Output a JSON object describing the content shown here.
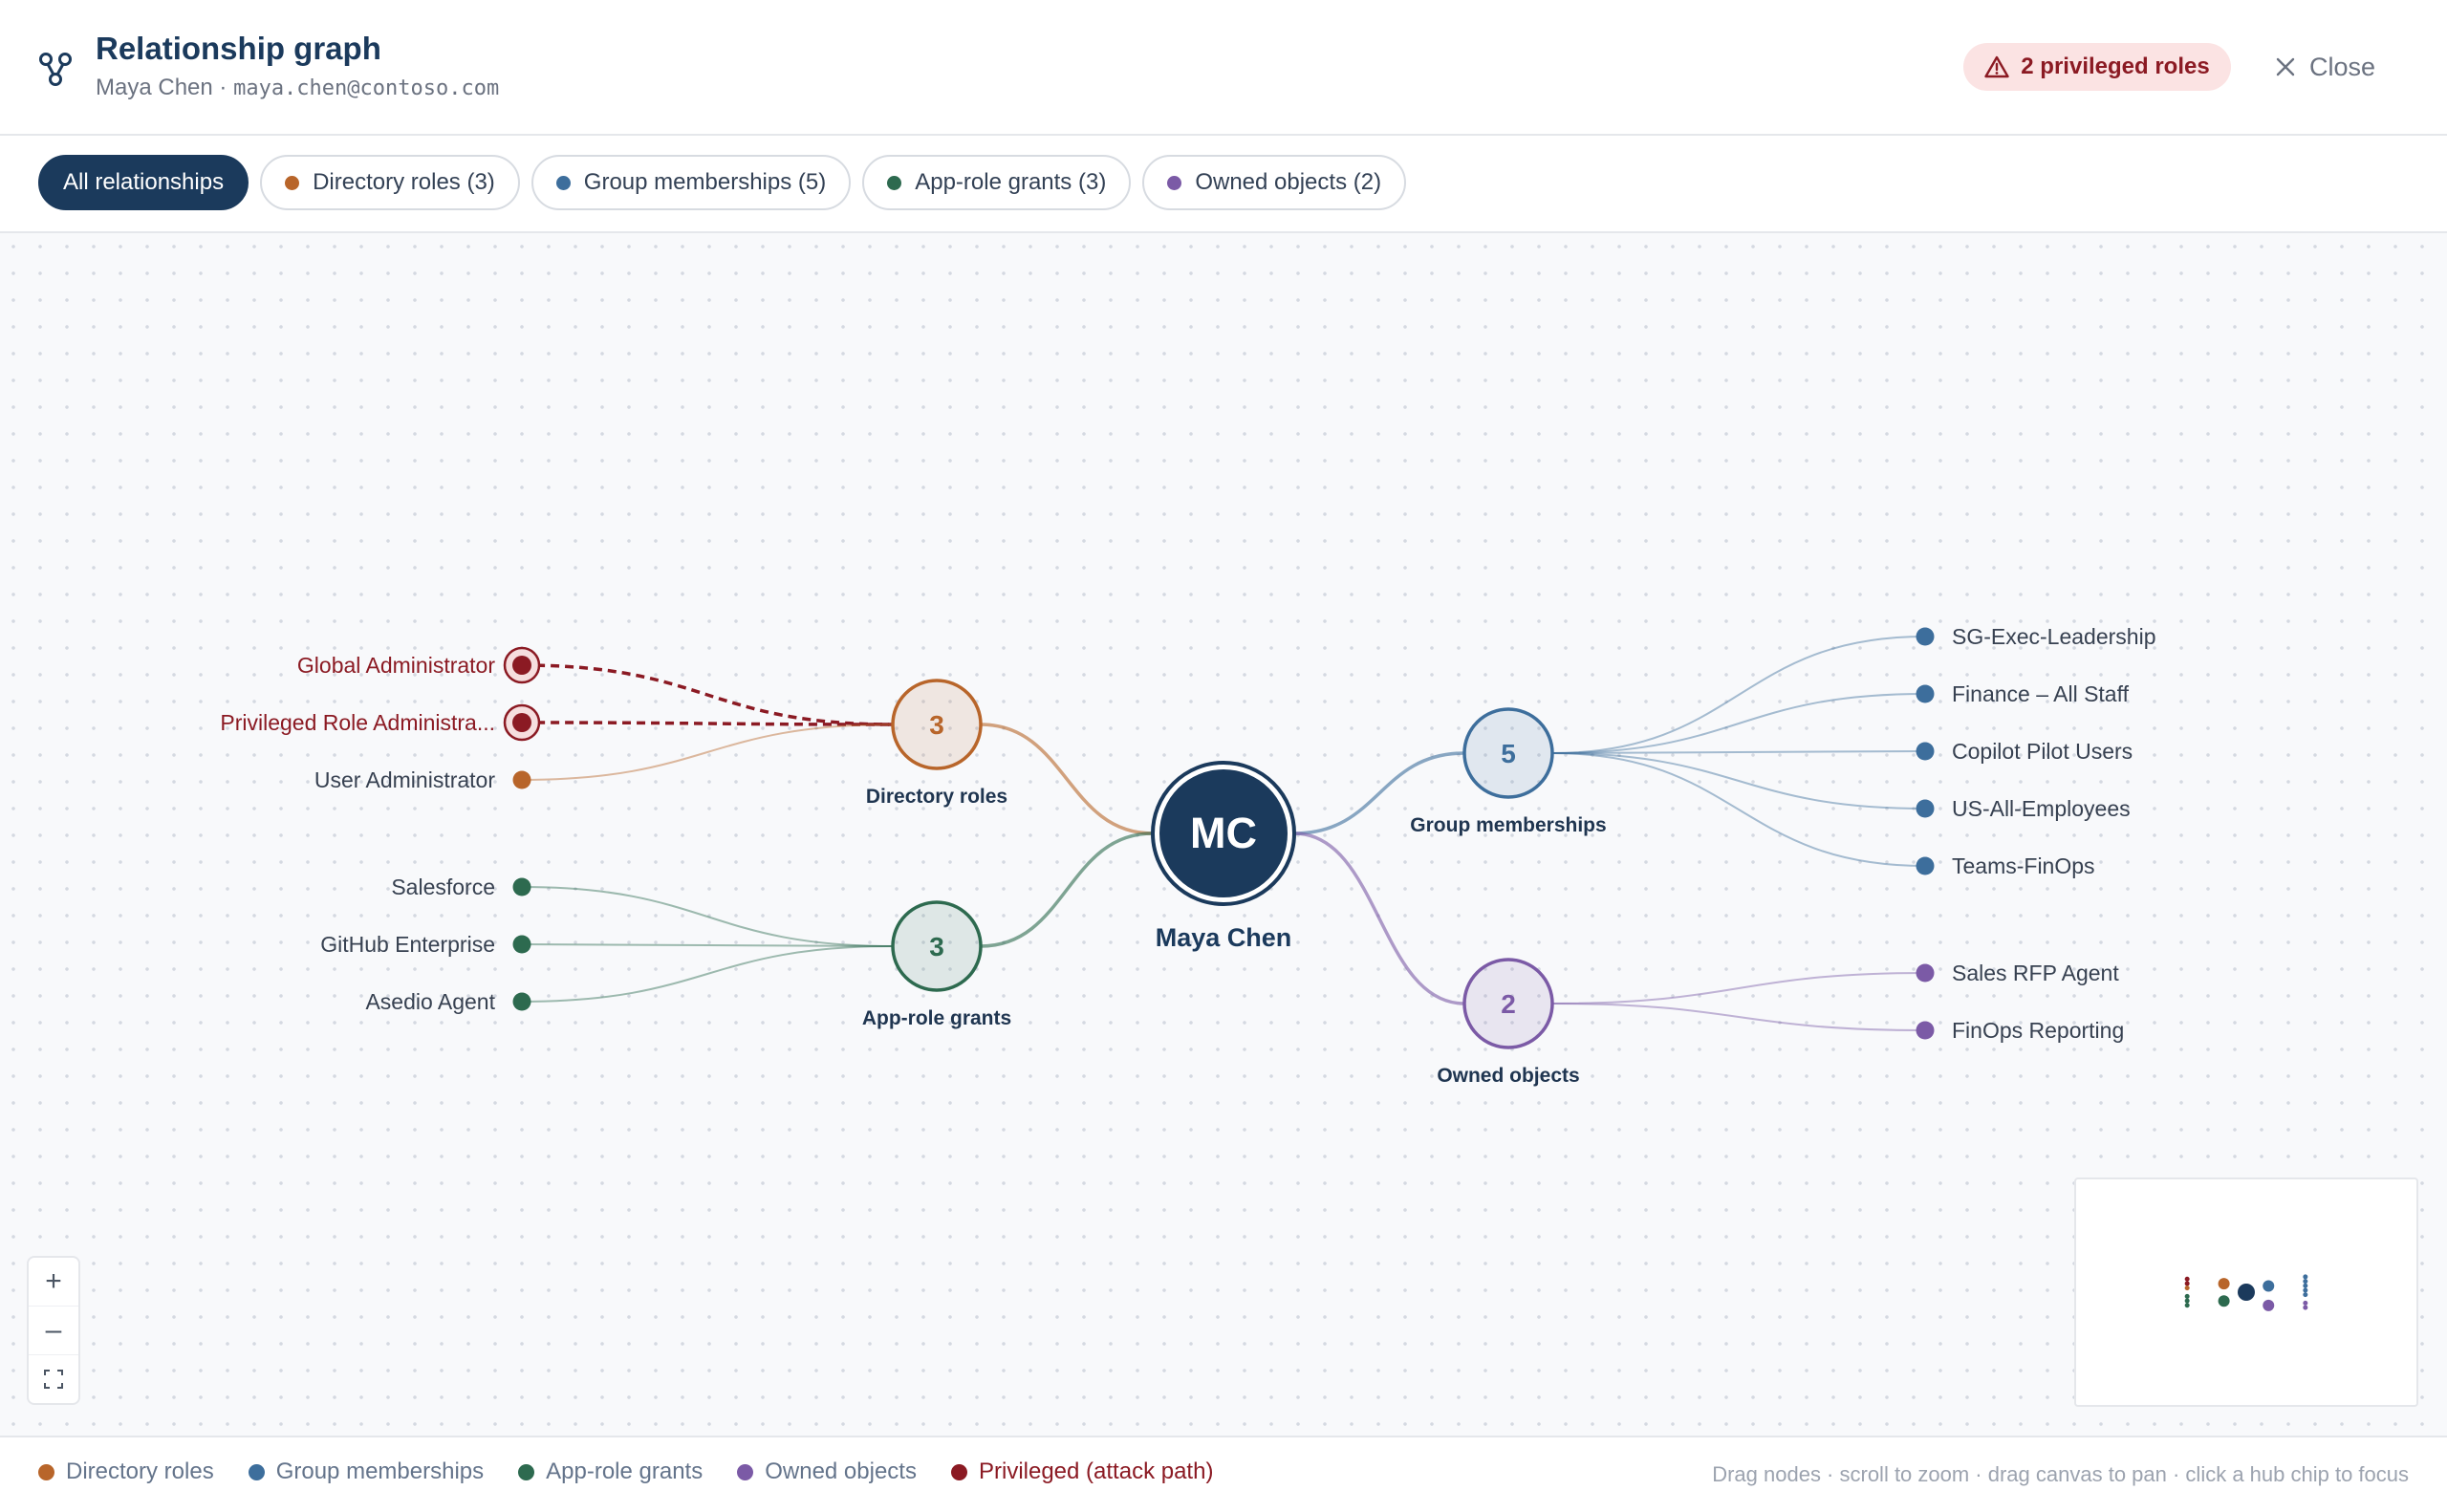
{
  "header": {
    "title": "Relationship graph",
    "user_name": "Maya Chen",
    "separator": "·",
    "user_email": "maya.chen@contoso.com",
    "privileged_badge": "2 privileged roles",
    "close_label": "Close"
  },
  "filters": [
    {
      "label": "All relationships",
      "active": true
    },
    {
      "label": "Directory roles (3)",
      "color": "#b8652a"
    },
    {
      "label": "Group memberships (5)",
      "color": "#3d6e9c"
    },
    {
      "label": "App-role grants (3)",
      "color": "#2d6a4f"
    },
    {
      "label": "Owned objects (2)",
      "color": "#7b5aa6"
    }
  ],
  "graph": {
    "center": {
      "initials": "MC",
      "name": "Maya Chen"
    },
    "hubs": [
      {
        "key": "directory-roles",
        "label": "Directory roles",
        "count": "3",
        "color": "#b8652a",
        "leaves": [
          {
            "label": "Global Administrator",
            "privileged": true
          },
          {
            "label": "Privileged Role Administra...",
            "privileged": true
          },
          {
            "label": "User Administrator",
            "privileged": false
          }
        ]
      },
      {
        "key": "app-role-grants",
        "label": "App-role grants",
        "count": "3",
        "color": "#2d6a4f",
        "leaves": [
          {
            "label": "Salesforce"
          },
          {
            "label": "GitHub Enterprise"
          },
          {
            "label": "Asedio Agent"
          }
        ]
      },
      {
        "key": "group-memberships",
        "label": "Group memberships",
        "count": "5",
        "color": "#3d6e9c",
        "leaves": [
          {
            "label": "SG-Exec-Leadership"
          },
          {
            "label": "Finance – All Staff"
          },
          {
            "label": "Copilot Pilot Users"
          },
          {
            "label": "US-All-Employees"
          },
          {
            "label": "Teams-FinOps"
          }
        ]
      },
      {
        "key": "owned-objects",
        "label": "Owned objects",
        "count": "2",
        "color": "#7b5aa6",
        "leaves": [
          {
            "label": "Sales RFP Agent"
          },
          {
            "label": "FinOps Reporting"
          }
        ]
      }
    ]
  },
  "colors": {
    "center": "#1b3a5c",
    "privileged": "#8b1a23"
  },
  "zoom": {
    "in": "+",
    "out": "–",
    "fit": "⛶"
  },
  "legend": [
    {
      "label": "Directory roles",
      "color": "#b8652a"
    },
    {
      "label": "Group memberships",
      "color": "#3d6e9c"
    },
    {
      "label": "App-role grants",
      "color": "#2d6a4f"
    },
    {
      "label": "Owned objects",
      "color": "#7b5aa6"
    },
    {
      "label": "Privileged (attack path)",
      "color": "#8b1a23",
      "privileged": true
    }
  ],
  "hint": "Drag nodes · scroll to zoom · drag canvas to pan · click a hub chip to focus"
}
